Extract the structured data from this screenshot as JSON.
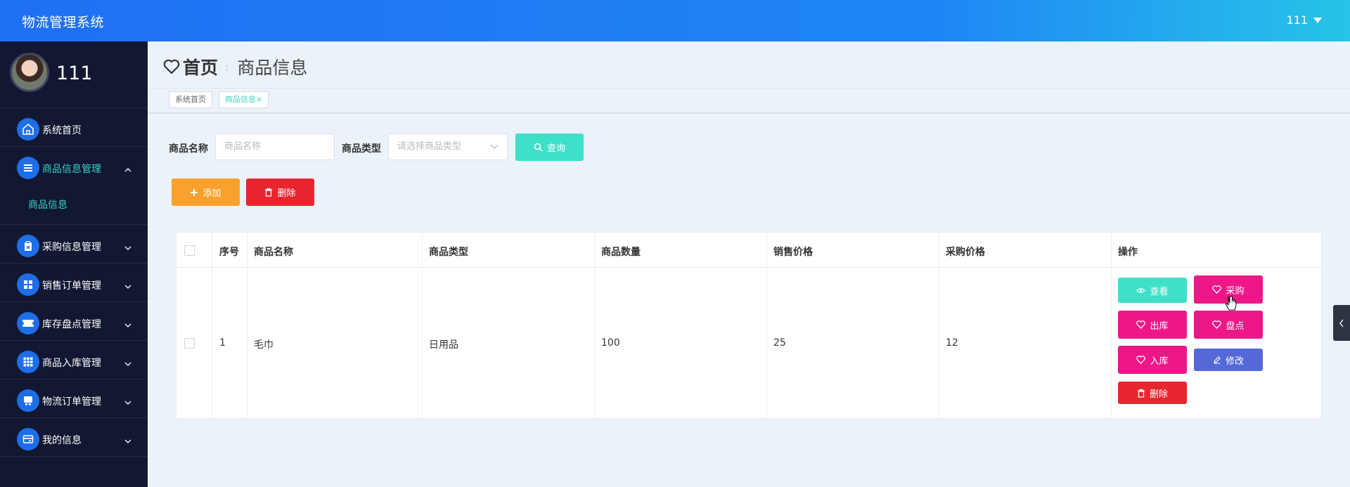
{
  "header": {
    "app_title": "物流管理系统",
    "user": "111"
  },
  "sidebar": {
    "profile_name": "111",
    "items": [
      {
        "label": "系统首页",
        "icon": "home-icon"
      },
      {
        "label": "商品信息管理",
        "icon": "list-icon",
        "expanded": true,
        "children": [
          {
            "label": "商品信息"
          }
        ]
      },
      {
        "label": "采购信息管理",
        "icon": "clipboard-icon"
      },
      {
        "label": "销售订单管理",
        "icon": "grid-icon"
      },
      {
        "label": "库存盘点管理",
        "icon": "ticket-icon"
      },
      {
        "label": "商品入库管理",
        "icon": "apps-icon"
      },
      {
        "label": "物流订单管理",
        "icon": "truck-icon"
      },
      {
        "label": "我的信息",
        "icon": "wallet-icon"
      }
    ]
  },
  "breadcrumb": {
    "home": "首页",
    "current": "商品信息"
  },
  "tags": [
    {
      "label": "系统首页"
    },
    {
      "label": "商品信息",
      "close": "×"
    }
  ],
  "search": {
    "name_label": "商品名称",
    "name_placeholder": "商品名称",
    "type_label": "商品类型",
    "type_placeholder": "请选择商品类型",
    "query_button": "查询"
  },
  "toolbar": {
    "add": "添加",
    "delete": "删除"
  },
  "table": {
    "columns": [
      "序号",
      "商品名称",
      "商品类型",
      "商品数量",
      "销售价格",
      "采购价格",
      "操作"
    ],
    "rows": [
      {
        "index": "1",
        "name": "毛巾",
        "type": "日用品",
        "quantity": "100",
        "sale_price": "25",
        "purchase_price": "12"
      }
    ],
    "actions": {
      "view": "查看",
      "purchase": "采购",
      "outbound": "出库",
      "inventory": "盘点",
      "inbound": "入库",
      "edit": "修改",
      "delete": "删除"
    }
  },
  "colors": {
    "header_start": "#1f6ff2",
    "header_end": "#27c4e8",
    "sidebar": "#121732",
    "accent": "#39d4c3",
    "pink": "#ee1788",
    "red": "#e9252f",
    "orange": "#f8a12c",
    "blue": "#5468d8"
  }
}
